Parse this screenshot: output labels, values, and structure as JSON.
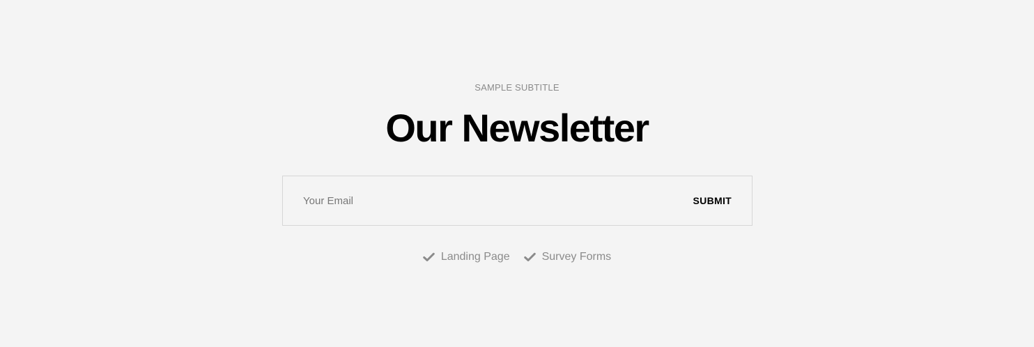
{
  "colors": {
    "background": "#f4f4f4",
    "title": "#000000",
    "muted_text": "#8b8b8b",
    "border": "#d6d6d6"
  },
  "newsletter": {
    "subtitle": "SAMPLE SUBTITLE",
    "title": "Our Newsletter",
    "email_placeholder": "Your Email",
    "email_value": "",
    "submit_label": "SUBMIT"
  },
  "features": {
    "items": [
      {
        "icon": "check-icon",
        "label": "Landing Page"
      },
      {
        "icon": "check-icon",
        "label": "Survey Forms"
      }
    ]
  }
}
